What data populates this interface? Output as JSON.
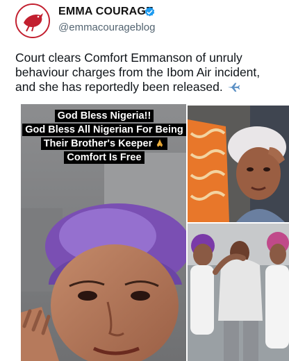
{
  "account": {
    "name": "EMMA COURAGE",
    "handle": "@emmacourageblog",
    "verified_color": "#1d9bf0",
    "brand_color": "#c21f2f"
  },
  "tweet": {
    "text": "Court clears Comfort Emmanson of unruly behaviour charges from the Ibom Air incident, and she has reportedly been released."
  },
  "caption": {
    "lines": [
      "God Bless Nigeria!!",
      "God Bless All Nigerian For Being",
      "Their Brother's Keeper",
      "Comfort Is Free"
    ]
  },
  "icons": [
    "bird-logo-icon",
    "verified-badge-icon",
    "airplane-icon",
    "praying-hands-icon"
  ]
}
